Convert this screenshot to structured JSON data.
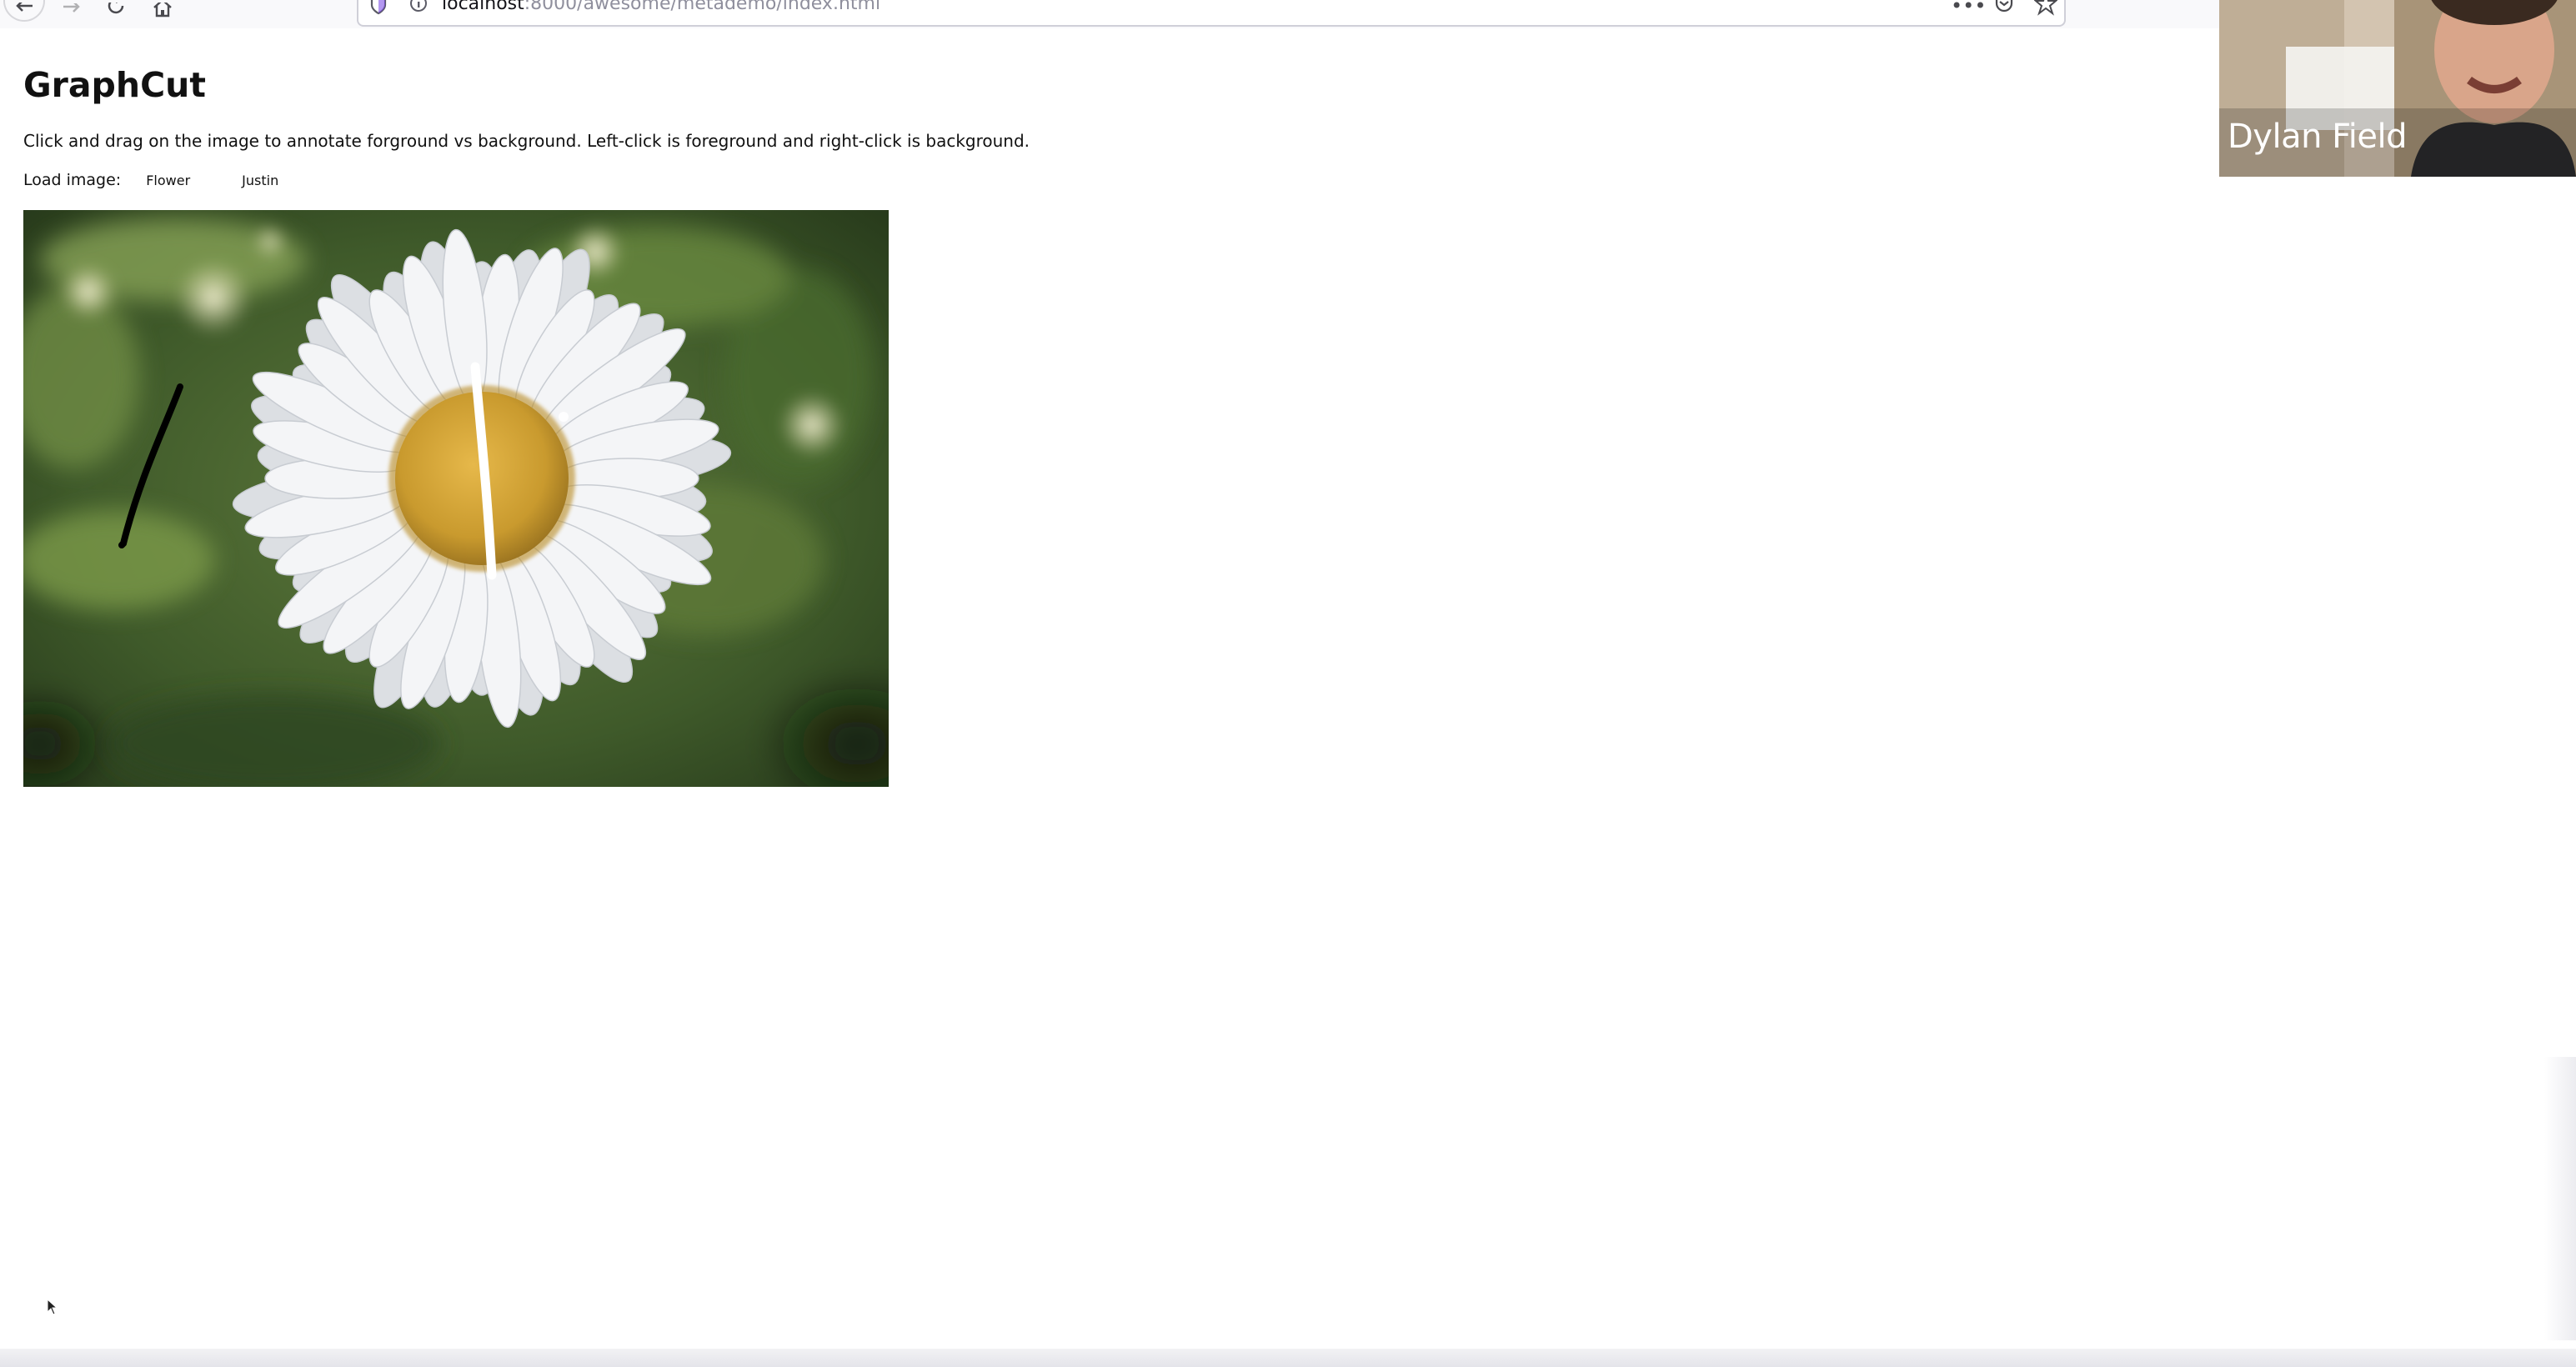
{
  "browser": {
    "url_host": "localhost",
    "url_rest": ":8000/awesome/metademo/index.html",
    "icons": {
      "back": "back-arrow-icon",
      "forward": "forward-arrow-icon",
      "reload": "reload-icon",
      "home": "home-icon",
      "shield": "shield-icon",
      "info": "info-icon",
      "more": "more-actions-icon",
      "pocket": "pocket-icon",
      "bookmark": "bookmark-star-icon"
    }
  },
  "page": {
    "title": "GraphCut",
    "instructions": "Click and drag on the image to annotate forground vs background. Left-click is foreground and right-click is background.",
    "load_label": "Load image:",
    "buttons": [
      "Flower",
      "Justin"
    ]
  },
  "canvas": {
    "image_subject": "white daisy flower on blurred green background",
    "strokes": [
      {
        "type": "foreground",
        "color": "#ffffff"
      },
      {
        "type": "background",
        "color": "#000000"
      }
    ]
  },
  "video": {
    "participant_name": "Dylan Field"
  }
}
